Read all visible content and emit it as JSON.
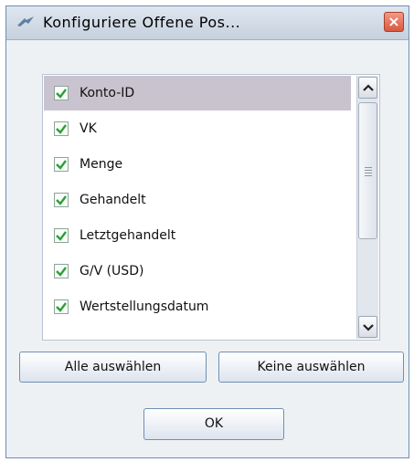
{
  "window": {
    "title": "Konfiguriere Offene Pos...",
    "close_label": "×"
  },
  "columns_list": {
    "items": [
      {
        "label": "Konto-ID",
        "checked": true,
        "selected": true
      },
      {
        "label": "VK",
        "checked": true,
        "selected": false
      },
      {
        "label": "Menge",
        "checked": true,
        "selected": false
      },
      {
        "label": "Gehandelt",
        "checked": true,
        "selected": false
      },
      {
        "label": "Letztgehandelt",
        "checked": true,
        "selected": false
      },
      {
        "label": "G/V (USD)",
        "checked": true,
        "selected": false
      },
      {
        "label": "Wertstellungsdatum",
        "checked": true,
        "selected": false
      }
    ]
  },
  "buttons": {
    "select_all": "Alle auswählen",
    "select_none": "Keine auswählen",
    "ok": "OK"
  },
  "colors": {
    "check_green": "#2f9e3a",
    "close_red": "#d9573f",
    "selection": "#c9c3d0"
  },
  "icons": {
    "app": "app-logo-icon",
    "close": "close-icon",
    "check": "checkmark-icon",
    "scroll_up": "chevron-up-icon",
    "scroll_down": "chevron-down-icon"
  }
}
